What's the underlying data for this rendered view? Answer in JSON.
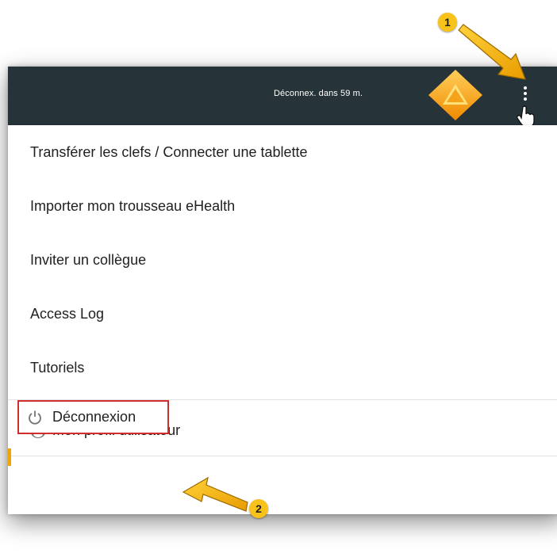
{
  "topbar": {
    "timer_text": "Déconnex. dans 59 m."
  },
  "menu": {
    "items": [
      {
        "label": "Transférer les clefs / Connecter une tablette"
      },
      {
        "label": "Importer mon trousseau eHealth"
      },
      {
        "label": "Inviter un collègue"
      },
      {
        "label": "Access Log"
      },
      {
        "label": "Tutoriels"
      }
    ],
    "profile_label": "Mon profil utilisateur",
    "logout_label": "Déconnexion"
  },
  "annotations": {
    "step1": "1",
    "step2": "2"
  },
  "colors": {
    "topbar": "#263339",
    "logo_orange": "#f5a623",
    "annotation_yellow": "#f7c21a",
    "highlight_red": "#d22d2d"
  },
  "icons": [
    "app-logo-icon",
    "kebab-menu-icon",
    "hand-cursor-icon",
    "user-icon",
    "power-icon",
    "arrow-icon"
  ]
}
